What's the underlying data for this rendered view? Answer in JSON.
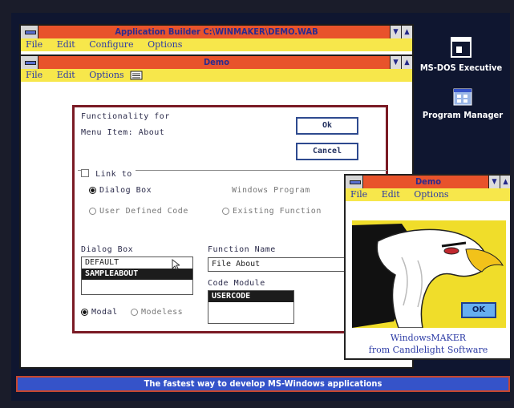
{
  "app_builder": {
    "title": "Application Builder   C:\\WINMAKER\\DEMO.WAB",
    "menu": [
      "File",
      "Edit",
      "Configure",
      "Options"
    ]
  },
  "demo_window": {
    "title": "Demo",
    "menu": [
      "File",
      "Edit",
      "Options"
    ]
  },
  "dialog": {
    "functionality_for": "Functionality for",
    "menu_item": "Menu Item: About",
    "ok_label": "Ok",
    "cancel_label": "Cancel",
    "link_to_label": "Link to",
    "radio_dialog_box": "Dialog Box",
    "radio_windows_program": "Windows Program",
    "radio_user_defined_code": "User Defined Code",
    "radio_existing_function": "Existing Function",
    "dialog_box_heading": "Dialog Box",
    "dialog_box_list": [
      "DEFAULT",
      "SAMPLEABOUT"
    ],
    "function_name_heading": "Function Name",
    "function_name_value": "File About",
    "code_module_heading": "Code Module",
    "code_module_value": "USERCODE",
    "modal_label": "Modal",
    "modeless_label": "Modeless"
  },
  "demo_popup": {
    "title": "Demo",
    "menu": [
      "File",
      "Edit",
      "Options"
    ],
    "ok_label": "OK",
    "caption_line1": "WindowsMAKER",
    "caption_line2": "from Candlelight Software"
  },
  "desktop": {
    "msdos_label": "MS-DOS Executive",
    "progman_label": "Program Manager"
  },
  "banner_text": "The fastest way to develop MS-Windows applications",
  "colors": {
    "titlebar": "#e8532b",
    "menubar": "#f7e74b",
    "desktop": "#0f1630",
    "banner": "#3553c9"
  }
}
